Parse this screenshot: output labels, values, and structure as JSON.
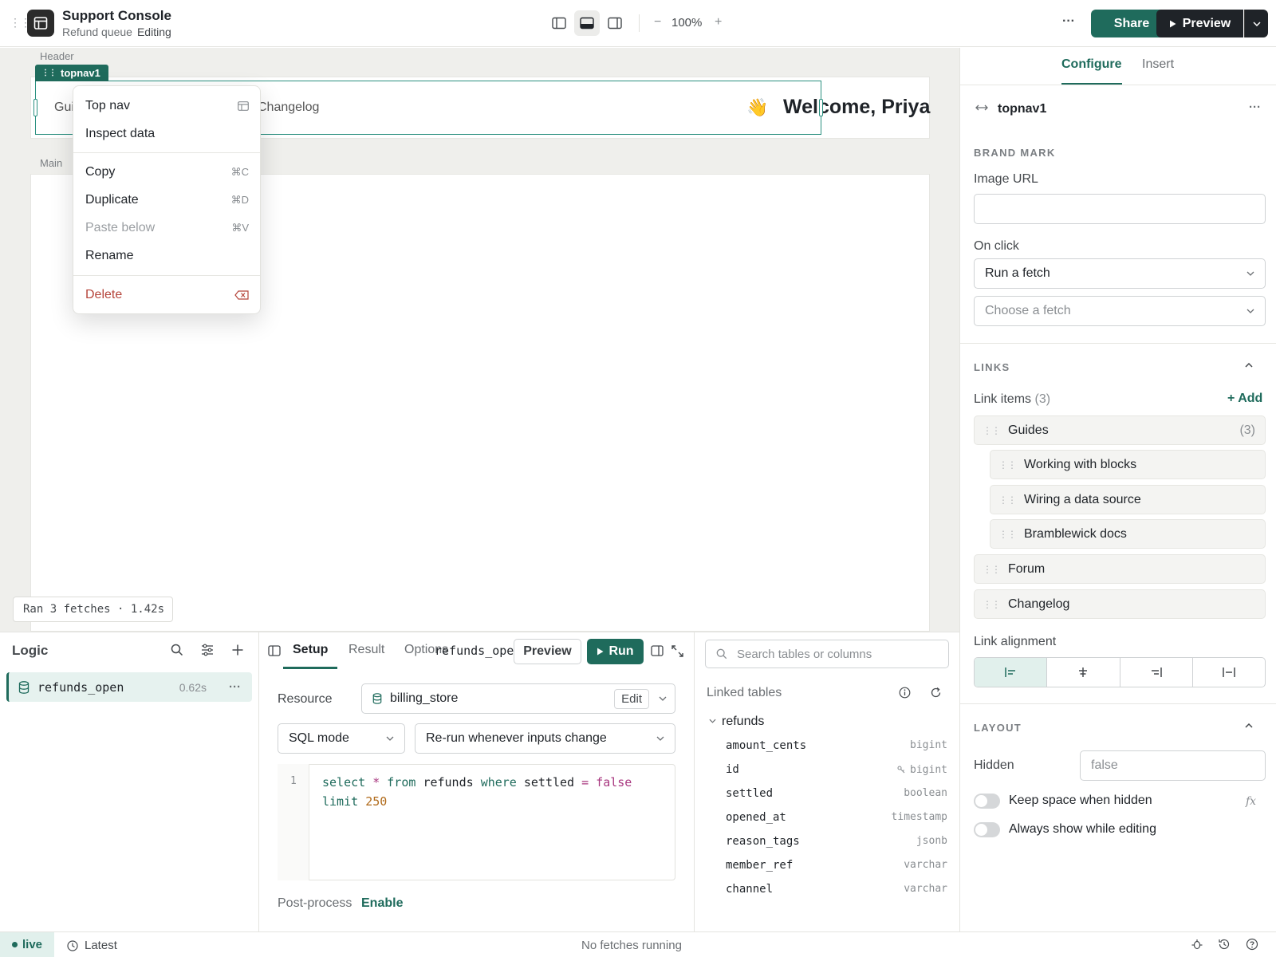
{
  "app": {
    "title": "Support Console",
    "subtitle": "Refund queue",
    "mode": "Editing"
  },
  "toolbar": {
    "zoom": "100%",
    "zoom_minus": "−",
    "zoom_plus": "+",
    "share": "Share",
    "preview": "Preview",
    "more": "···"
  },
  "canvas": {
    "header_label": "Header",
    "main_label": "Main",
    "selected_component": "topnav1",
    "nav_links_visible": [
      "Gui",
      "Changelog"
    ],
    "wave": "👋",
    "welcome": "Welcome, Priya",
    "run_status": "Ran 3 fetches · 1.42s"
  },
  "context_menu": {
    "items": [
      {
        "label": "Top nav",
        "shortcut": "",
        "state": "normal"
      },
      {
        "label": "Inspect data",
        "shortcut": "",
        "state": "normal"
      },
      {
        "label": "Copy",
        "shortcut": "⌘C",
        "state": "normal"
      },
      {
        "label": "Duplicate",
        "shortcut": "⌘D",
        "state": "normal"
      },
      {
        "label": "Paste below",
        "shortcut": "⌘V",
        "state": "disabled"
      },
      {
        "label": "Rename",
        "shortcut": "",
        "state": "normal"
      },
      {
        "label": "Delete",
        "shortcut": "",
        "state": "danger"
      }
    ]
  },
  "right_panel": {
    "tabs": [
      "Configure",
      "Insert"
    ],
    "component_name": "topnav1",
    "brand_mark": {
      "heading": "BRAND MARK",
      "image_url_label": "Image URL",
      "image_url_value": "",
      "on_click_label": "On click",
      "on_click_value": "Run a fetch",
      "fetch_placeholder": "Choose a fetch"
    },
    "links": {
      "heading": "LINKS",
      "items_label": "Link items",
      "items_count": "(3)",
      "add": "+ Add",
      "groups": [
        {
          "label": "Guides",
          "count": "(3)",
          "children": [
            "Working with blocks",
            "Wiring a data source",
            "Bramblewick docs"
          ]
        },
        {
          "label": "Forum",
          "count": "",
          "children": []
        },
        {
          "label": "Changelog",
          "count": "",
          "children": []
        }
      ],
      "alignment_label": "Link alignment",
      "alignment_selected": "left"
    },
    "layout": {
      "heading": "LAYOUT",
      "hidden_label": "Hidden",
      "hidden_placeholder": "false",
      "keep_space": "Keep space when hidden",
      "fx": "fx",
      "always_show": "Always show while editing"
    }
  },
  "logic": {
    "title": "Logic",
    "queries": [
      {
        "name": "refunds_open",
        "time": "0.62s"
      }
    ]
  },
  "editor": {
    "tabs": [
      "Setup",
      "Result",
      "Options"
    ],
    "query_name": "refunds_open",
    "preview": "Preview",
    "run": "Run",
    "resource_label": "Resource",
    "resource": "billing_store",
    "edit": "Edit",
    "mode": "SQL mode",
    "trigger": "Re-run whenever inputs change",
    "line_no": "1",
    "sql_line1": {
      "kw_select": "select",
      "star": "*",
      "kw_from": "from",
      "table": "refunds",
      "kw_where": "where",
      "col": "settled",
      "eq": "=",
      "val": "false"
    },
    "sql_line2": {
      "kw_limit": "limit",
      "num": "250"
    },
    "post_process_label": "Post-process",
    "post_process_action": "Enable"
  },
  "schema": {
    "search_placeholder": "Search tables or columns",
    "linked_tables_label": "Linked tables",
    "table": "refunds",
    "columns": [
      {
        "name": "amount_cents",
        "type": "bigint"
      },
      {
        "name": "id",
        "type": "bigint"
      },
      {
        "name": "settled",
        "type": "boolean"
      },
      {
        "name": "opened_at",
        "type": "timestamp"
      },
      {
        "name": "reason_tags",
        "type": "jsonb"
      },
      {
        "name": "member_ref",
        "type": "varchar"
      },
      {
        "name": "channel",
        "type": "varchar"
      }
    ]
  },
  "status_bar": {
    "env": "live",
    "version": "Latest",
    "fetch_status": "No fetches running"
  },
  "colors": {
    "accent": "#1f6b5c",
    "danger": "#b5443a",
    "selection": "#2b9080"
  }
}
